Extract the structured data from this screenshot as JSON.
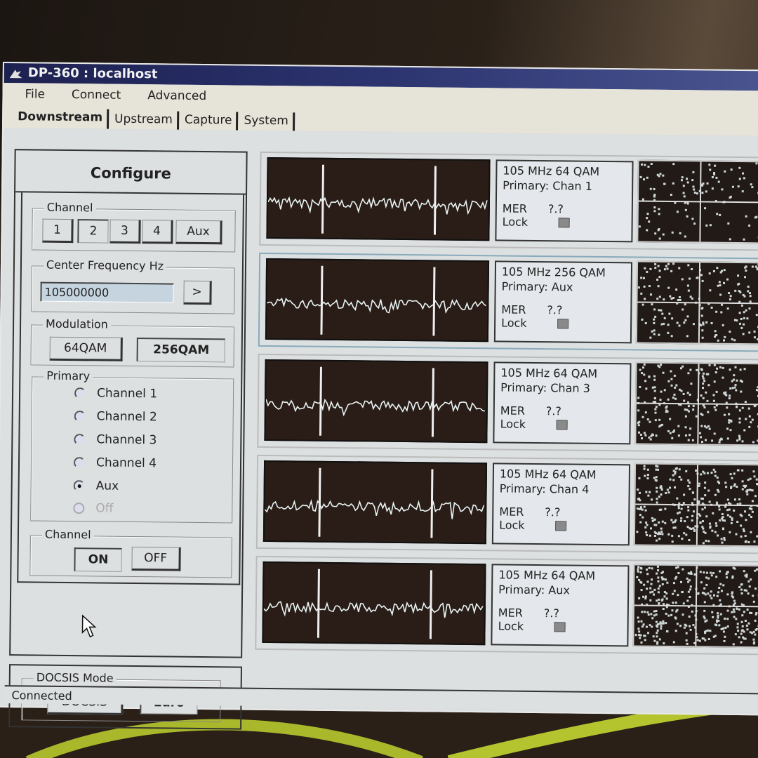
{
  "window": {
    "title": "DP-360 : localhost",
    "app_icon": "dp360-logo-icon"
  },
  "menu": {
    "items": [
      {
        "label": "File"
      },
      {
        "label": "Connect"
      },
      {
        "label": "Advanced"
      }
    ]
  },
  "tabs": [
    {
      "label": "Downstream",
      "active": true
    },
    {
      "label": "Upstream",
      "active": false
    },
    {
      "label": "Capture",
      "active": false
    },
    {
      "label": "System",
      "active": false
    }
  ],
  "configure": {
    "title": "Configure",
    "channel": {
      "label": "Channel",
      "buttons": [
        "1",
        "2",
        "3",
        "4",
        "Aux"
      ],
      "selected": "2"
    },
    "center_frequency": {
      "label": "Center Frequency Hz",
      "value": "105000000",
      "apply_label": ">"
    },
    "modulation": {
      "label": "Modulation",
      "options": [
        "64QAM",
        "256QAM"
      ],
      "selected": "256QAM"
    },
    "primary": {
      "label": "Primary",
      "options": [
        {
          "label": "Channel 1",
          "checked": false,
          "enabled": true
        },
        {
          "label": "Channel 2",
          "checked": false,
          "enabled": true
        },
        {
          "label": "Channel 3",
          "checked": false,
          "enabled": true
        },
        {
          "label": "Channel 4",
          "checked": false,
          "enabled": true
        },
        {
          "label": "Aux",
          "checked": true,
          "enabled": true
        },
        {
          "label": "Off",
          "checked": false,
          "enabled": false
        }
      ]
    },
    "channel_power": {
      "label": "Channel",
      "on_label": "ON",
      "off_label": "OFF",
      "selected": "ON"
    }
  },
  "docsis_mode": {
    "label": "DOCSIS Mode",
    "options": [
      "DOCSIS",
      "Euro"
    ],
    "selected": "Euro"
  },
  "channels": [
    {
      "freq_mod": "105 MHz  64 QAM",
      "primary": "Primary: Chan 1",
      "mer_label": "MER",
      "mer_value": "?.?",
      "lock_label": "Lock",
      "locked": false
    },
    {
      "freq_mod": "105 MHz  256 QAM",
      "primary": "Primary: Aux",
      "mer_label": "MER",
      "mer_value": "?.?",
      "lock_label": "Lock",
      "locked": false
    },
    {
      "freq_mod": "105 MHz  64 QAM",
      "primary": "Primary: Chan 3",
      "mer_label": "MER",
      "mer_value": "?.?",
      "lock_label": "Lock",
      "locked": false
    },
    {
      "freq_mod": "105 MHz  64 QAM",
      "primary": "Primary: Chan 4",
      "mer_label": "MER",
      "mer_value": "?.?",
      "lock_label": "Lock",
      "locked": false
    },
    {
      "freq_mod": "105 MHz  64 QAM",
      "primary": "Primary: Aux",
      "mer_label": "MER",
      "mer_value": "?.?",
      "lock_label": "Lock",
      "locked": false
    }
  ],
  "status": {
    "text": "Connected"
  },
  "colors": {
    "titlebar": "#1d2150",
    "trace": "#e8f4f4",
    "scope_bg": "#2a1c16",
    "input_bg": "#c6d4e0"
  }
}
